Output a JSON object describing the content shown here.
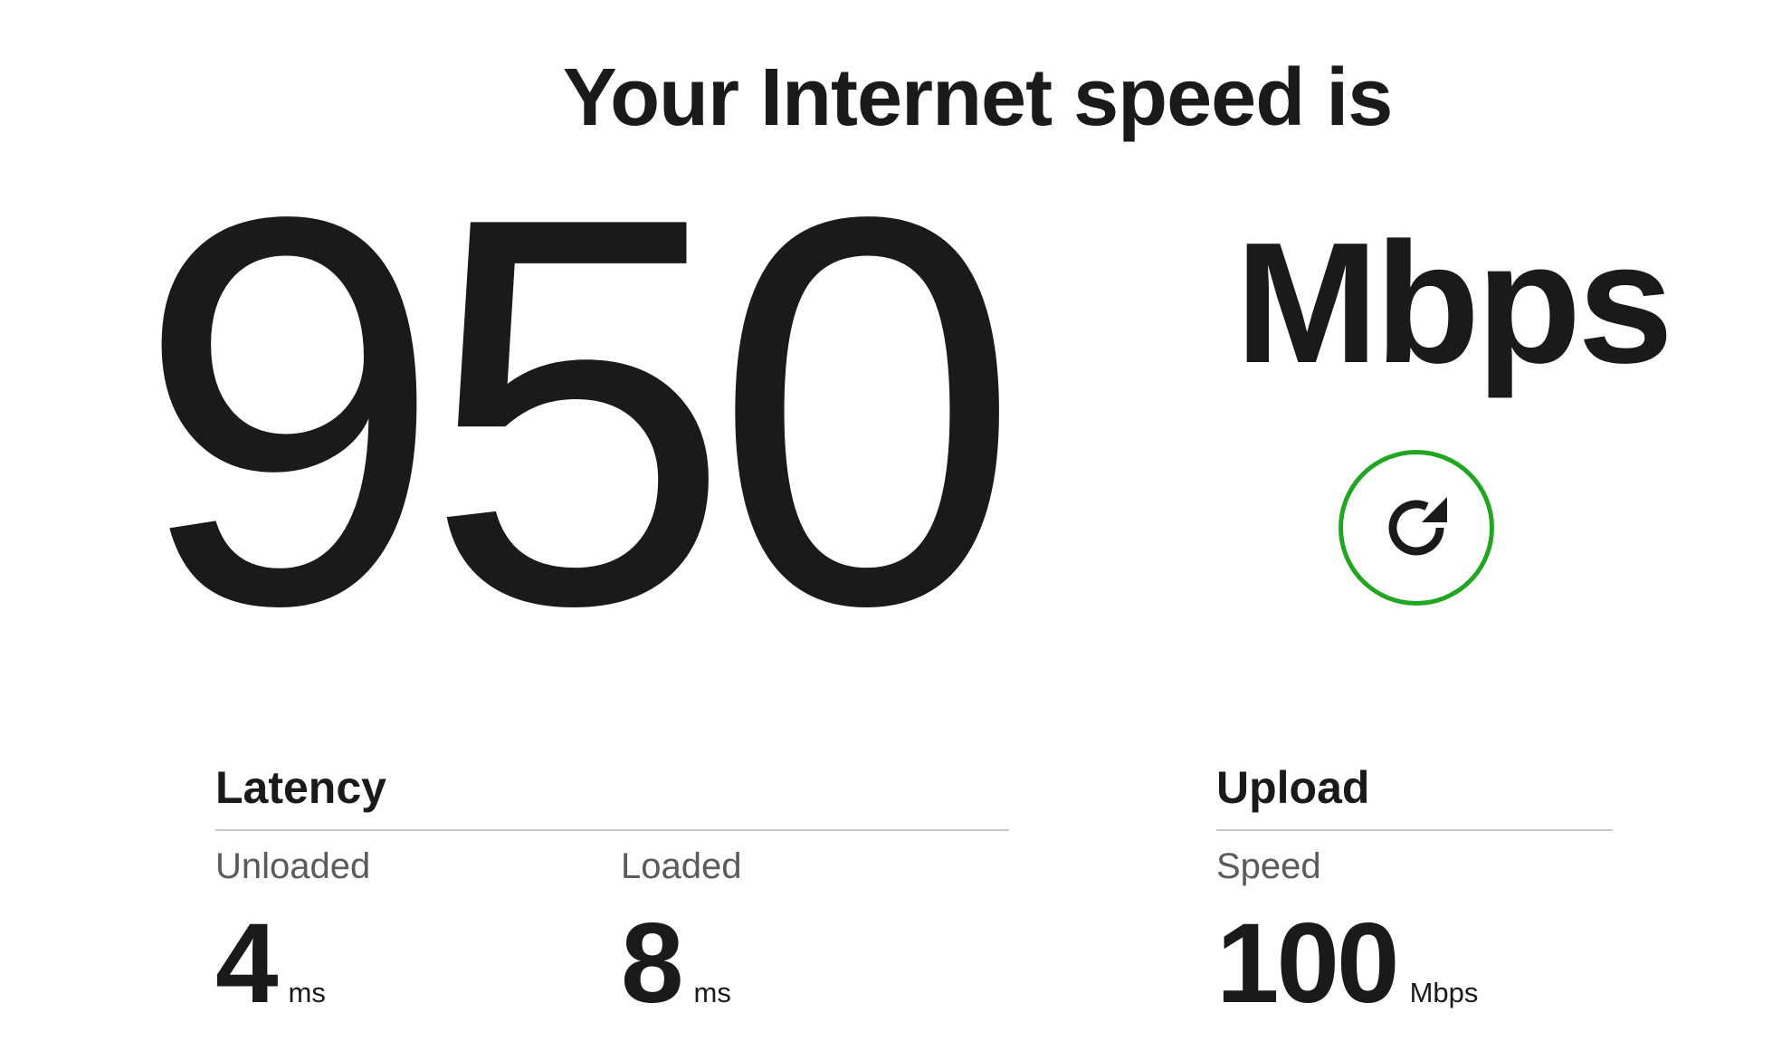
{
  "header": {
    "title": "Your Internet speed is"
  },
  "download": {
    "value": "950",
    "unit": "Mbps"
  },
  "refresh": {
    "icon": "refresh-icon",
    "ring_color": "#22a622"
  },
  "latency": {
    "title": "Latency",
    "unloaded": {
      "label": "Unloaded",
      "value": "4",
      "unit": "ms"
    },
    "loaded": {
      "label": "Loaded",
      "value": "8",
      "unit": "ms"
    }
  },
  "upload": {
    "title": "Upload",
    "speed": {
      "label": "Speed",
      "value": "100",
      "unit": "Mbps"
    }
  }
}
